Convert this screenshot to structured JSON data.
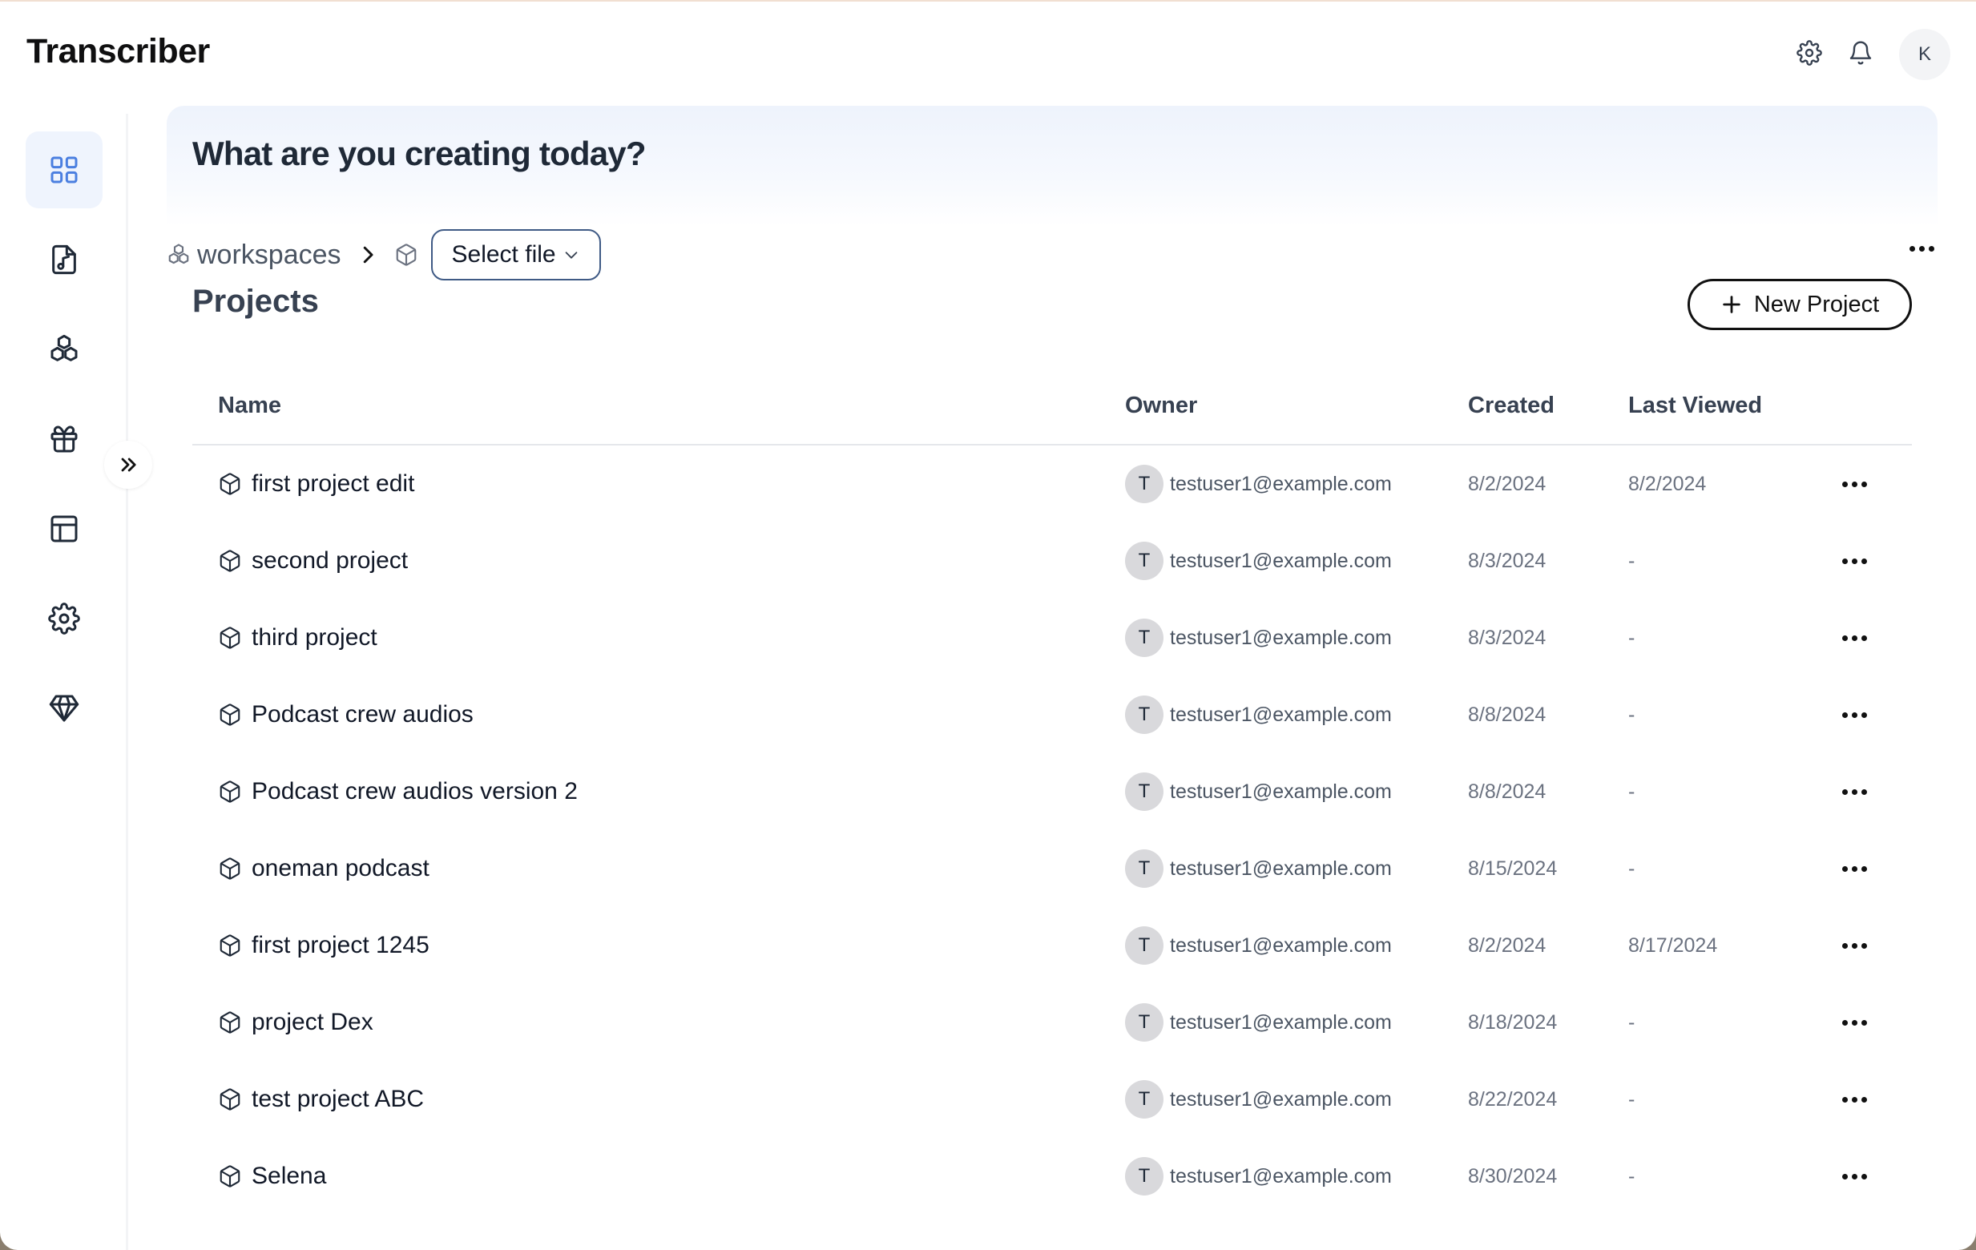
{
  "app": {
    "title": "Transcriber"
  },
  "header": {
    "avatar_initial": "K",
    "icons": [
      "gear-icon",
      "bell-icon"
    ]
  },
  "sidebar": {
    "items": [
      {
        "name": "dashboard",
        "icon": "grid-icon",
        "active": true
      },
      {
        "name": "audio",
        "icon": "music-file-icon",
        "active": false
      },
      {
        "name": "workspaces",
        "icon": "cubes-icon",
        "active": false
      },
      {
        "name": "gifts",
        "icon": "gift-icon",
        "active": false
      },
      {
        "name": "layout",
        "icon": "layout-icon",
        "active": false
      },
      {
        "name": "settings",
        "icon": "gear-icon",
        "active": false
      },
      {
        "name": "premium",
        "icon": "diamond-icon",
        "active": false
      }
    ]
  },
  "hero": {
    "title": "What are you creating today?"
  },
  "breadcrumb": {
    "workspaces": "workspaces",
    "select_file": "Select file"
  },
  "projects": {
    "title": "Projects",
    "new_button": "New Project",
    "columns": {
      "name": "Name",
      "owner": "Owner",
      "created": "Created",
      "last_viewed": "Last Viewed"
    },
    "rows": [
      {
        "name": "first project edit",
        "owner_initial": "T",
        "owner": "testuser1@example.com",
        "created": "8/2/2024",
        "last_viewed": "8/2/2024"
      },
      {
        "name": "second project",
        "owner_initial": "T",
        "owner": "testuser1@example.com",
        "created": "8/3/2024",
        "last_viewed": "-"
      },
      {
        "name": "third project",
        "owner_initial": "T",
        "owner": "testuser1@example.com",
        "created": "8/3/2024",
        "last_viewed": "-"
      },
      {
        "name": "Podcast crew audios",
        "owner_initial": "T",
        "owner": "testuser1@example.com",
        "created": "8/8/2024",
        "last_viewed": "-"
      },
      {
        "name": "Podcast crew audios version 2",
        "owner_initial": "T",
        "owner": "testuser1@example.com",
        "created": "8/8/2024",
        "last_viewed": "-"
      },
      {
        "name": "oneman podcast",
        "owner_initial": "T",
        "owner": "testuser1@example.com",
        "created": "8/15/2024",
        "last_viewed": "-"
      },
      {
        "name": "first project 1245",
        "owner_initial": "T",
        "owner": "testuser1@example.com",
        "created": "8/2/2024",
        "last_viewed": "8/17/2024"
      },
      {
        "name": "project Dex",
        "owner_initial": "T",
        "owner": "testuser1@example.com",
        "created": "8/18/2024",
        "last_viewed": "-"
      },
      {
        "name": "test project ABC",
        "owner_initial": "T",
        "owner": "testuser1@example.com",
        "created": "8/22/2024",
        "last_viewed": "-"
      },
      {
        "name": "Selena",
        "owner_initial": "T",
        "owner": "testuser1@example.com",
        "created": "8/30/2024",
        "last_viewed": "-"
      }
    ]
  },
  "colors": {
    "accent": "#4b7fe0",
    "active_bg": "#eff4fd",
    "select_border": "#3f5a85"
  }
}
